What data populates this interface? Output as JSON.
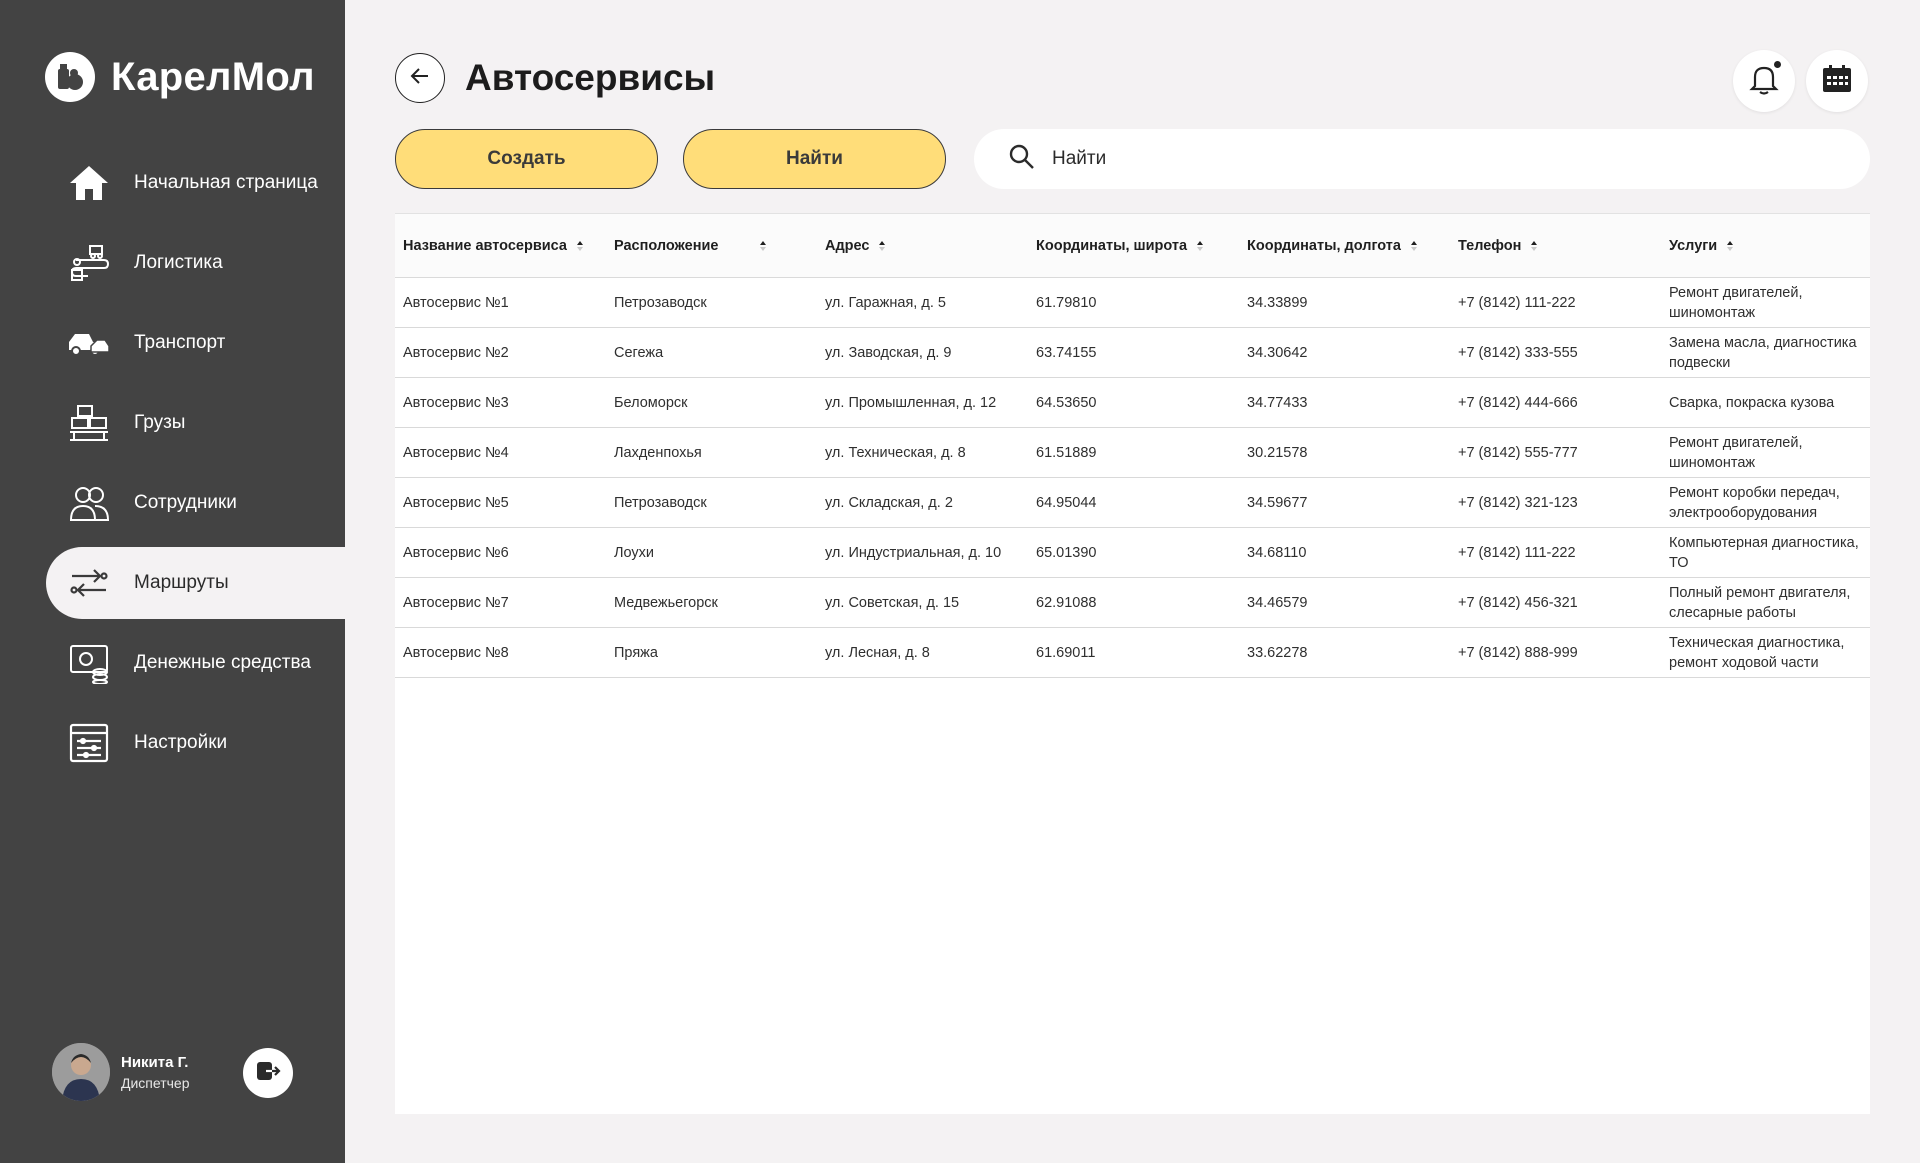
{
  "app": {
    "brand": "КарелМол"
  },
  "sidebar": {
    "items": [
      {
        "label": "Начальная страница",
        "icon": "home-icon"
      },
      {
        "label": "Логистика",
        "icon": "logistics-icon"
      },
      {
        "label": "Транспорт",
        "icon": "transport-icon"
      },
      {
        "label": "Грузы",
        "icon": "cargo-icon"
      },
      {
        "label": "Сотрудники",
        "icon": "employees-icon"
      },
      {
        "label": "Маршруты",
        "icon": "routes-icon",
        "active": true
      },
      {
        "label": "Денежные средства",
        "icon": "money-icon"
      },
      {
        "label": "Настройки",
        "icon": "settings-icon"
      }
    ]
  },
  "user": {
    "name": "Никита Г.",
    "role": "Диспетчер"
  },
  "header": {
    "title": "Автосервисы"
  },
  "toolbar": {
    "create_label": "Создать",
    "find_label": "Найти",
    "search_placeholder": "Найти"
  },
  "table": {
    "columns": [
      "Название автосервиса",
      "Расположение",
      "Адрес",
      "Координаты, широта",
      "Координаты, долгота",
      "Телефон",
      "Услуги"
    ],
    "rows": [
      [
        "Автосервис №1",
        "Петрозаводск",
        "ул. Гаражная, д. 5",
        "61.79810",
        "34.33899",
        "+7 (8142) 111-222",
        "Ремонт двигателей, шиномонтаж"
      ],
      [
        "Автосервис №2",
        "Сегежа",
        "ул. Заводская, д. 9",
        "63.74155",
        "34.30642",
        "+7 (8142) 333-555",
        "Замена масла, диагностика подвески"
      ],
      [
        "Автосервис №3",
        "Беломорск",
        "ул. Промышленная, д. 12",
        "64.53650",
        "34.77433",
        "+7 (8142) 444-666",
        "Сварка, покраска кузова"
      ],
      [
        "Автосервис №4",
        "Лахденпохья",
        "ул. Техническая, д. 8",
        "61.51889",
        "30.21578",
        "+7 (8142) 555-777",
        "Ремонт двигателей, шиномонтаж"
      ],
      [
        "Автосервис №5",
        "Петрозаводск",
        "ул. Складская, д. 2",
        "64.95044",
        "34.59677",
        "+7 (8142) 321-123",
        "Ремонт коробки передач, электрооборудования"
      ],
      [
        "Автосервис №6",
        "Лоухи",
        "ул. Индустриальная, д. 10",
        "65.01390",
        "34.68110",
        "+7 (8142) 111-222",
        "Компьютерная диагностика, ТО"
      ],
      [
        "Автосервис №7",
        "Медвежьегорск",
        "ул. Советская, д. 15",
        "62.91088",
        "34.46579",
        "+7 (8142) 456-321",
        "Полный ремонт двигателя, слесарные работы"
      ],
      [
        "Автосервис №8",
        "Пряжа",
        "ул. Лесная, д. 8",
        "61.69011",
        "33.62278",
        "+7 (8142) 888-999",
        "Техническая диагностика, ремонт ходовой части"
      ]
    ]
  },
  "colors": {
    "sidebar_bg": "#434343",
    "page_bg": "#f4f2f3",
    "accent_button": "#ffdd79"
  }
}
